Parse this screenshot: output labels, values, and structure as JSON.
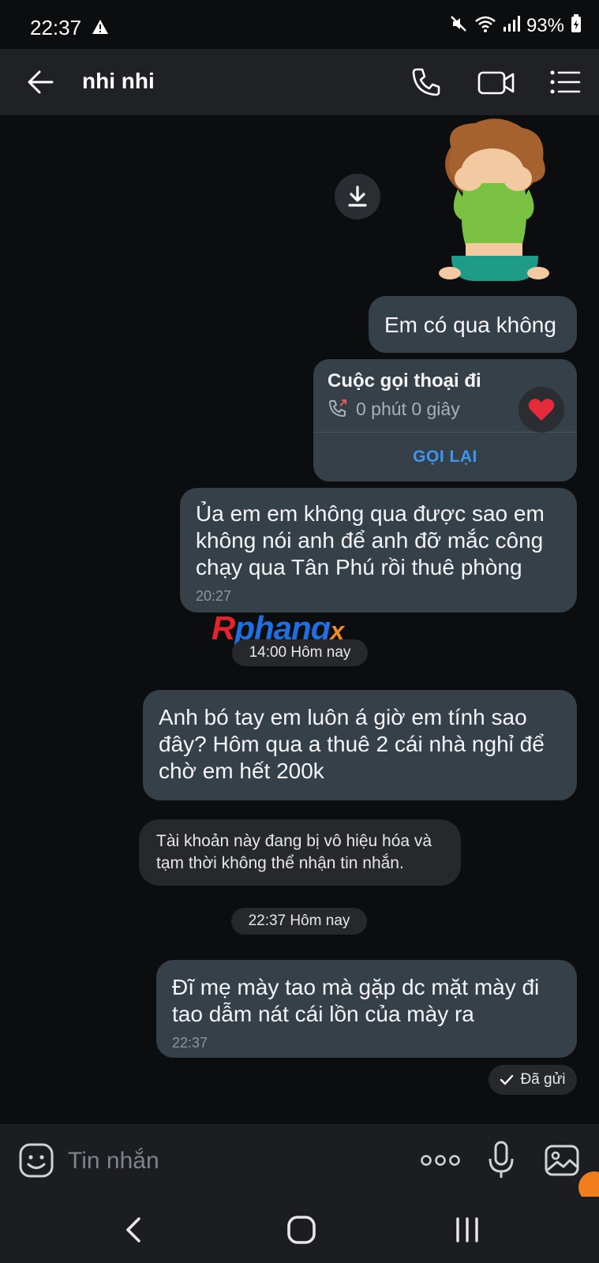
{
  "status_bar": {
    "time": "22:37",
    "battery": "93%"
  },
  "header": {
    "contact_name": "nhi nhi"
  },
  "messages": {
    "msg1": "Em có qua không",
    "call_card": {
      "title": "Cuộc gọi thoại đi",
      "duration": "0 phút 0 giây",
      "callback_label": "GỌI LẠI"
    },
    "msg2": {
      "text": "Ủa em em không qua được sao em không nói anh để anh đỡ mắc công chạy qua Tân Phú rồi thuê phòng",
      "time": "20:27"
    },
    "date1": "14:00 Hôm nay",
    "msg3": "Anh bó tay em luôn á giờ em tính sao đây? Hôm qua a thuê 2 cái nhà nghỉ để chờ em hết 200k",
    "system": "Tài khoản này đang bị vô hiệu hóa và tạm thời không thể nhận tin nhắn.",
    "date2": "22:37 Hôm nay",
    "msg4": {
      "text": "Đĩ mẹ mày tao mà gặp dc mặt mày đi tao dẫm nát cái lồn của mày ra",
      "time": "22:37"
    },
    "sent_status": "Đã gửi"
  },
  "watermark": {
    "part1": "R",
    "part2": "phang",
    "part3": "x"
  },
  "input": {
    "placeholder": "Tin nhắn"
  },
  "colors": {
    "bubble": "#364049",
    "background": "#0c0d0f",
    "link": "#3e96f0"
  }
}
